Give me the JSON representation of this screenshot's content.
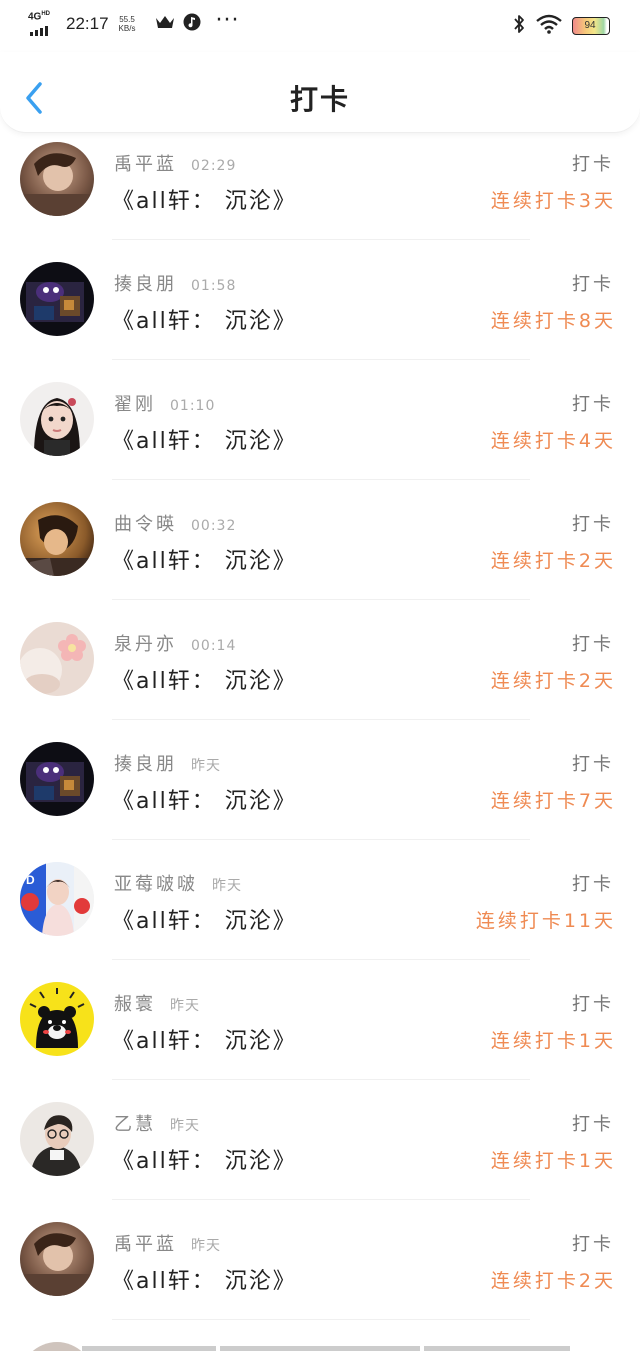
{
  "status_bar": {
    "network": "4G",
    "network_sup": "HD",
    "time": "22:17",
    "speed_value": "55.5",
    "speed_unit": "KB/s",
    "battery": "94",
    "icons": [
      "crown-icon",
      "music-icon",
      "more-dots-icon",
      "bluetooth-icon",
      "wifi-icon",
      "battery-icon"
    ]
  },
  "header": {
    "title": "打卡",
    "back_icon": "chevron-left-icon"
  },
  "colors": {
    "accent": "#3aa0f0",
    "streak": "#ef8a52"
  },
  "list": {
    "items": [
      {
        "name": "禹平蓝",
        "time": "02:29",
        "book": "《all轩： 沉沦》",
        "label": "打卡",
        "streak": "连续打卡3天",
        "avatar": "avatar-brown"
      },
      {
        "name": "揍良朋",
        "time": "01:58",
        "book": "《all轩： 沉沦》",
        "label": "打卡",
        "streak": "连续打卡8天",
        "avatar": "avatar-dark"
      },
      {
        "name": "翟刚",
        "time": "01:10",
        "book": "《all轩： 沉沦》",
        "label": "打卡",
        "streak": "连续打卡4天",
        "avatar": "avatar-girl"
      },
      {
        "name": "曲令暎",
        "time": "00:32",
        "book": "《all轩： 沉沦》",
        "label": "打卡",
        "streak": "连续打卡2天",
        "avatar": "avatar-amber"
      },
      {
        "name": "泉丹亦",
        "time": "00:14",
        "book": "《all轩： 沉沦》",
        "label": "打卡",
        "streak": "连续打卡2天",
        "avatar": "avatar-flower"
      },
      {
        "name": "揍良朋",
        "time": "昨天",
        "book": "《all轩： 沉沦》",
        "label": "打卡",
        "streak": "连续打卡7天",
        "avatar": "avatar-dark"
      },
      {
        "name": "亚莓啵啵",
        "time": "昨天",
        "book": "《all轩： 沉沦》",
        "label": "打卡",
        "streak": "连续打卡11天",
        "avatar": "avatar-idol"
      },
      {
        "name": "赧寰",
        "time": "昨天",
        "book": "《all轩： 沉沦》",
        "label": "打卡",
        "streak": "连续打卡1天",
        "avatar": "avatar-bear"
      },
      {
        "name": "乙慧",
        "time": "昨天",
        "book": "《all轩： 沉沦》",
        "label": "打卡",
        "streak": "连续打卡1天",
        "avatar": "avatar-man"
      },
      {
        "name": "禹平蓝",
        "time": "昨天",
        "book": "《all轩： 沉沦》",
        "label": "打卡",
        "streak": "连续打卡2天",
        "avatar": "avatar-brown"
      }
    ]
  }
}
